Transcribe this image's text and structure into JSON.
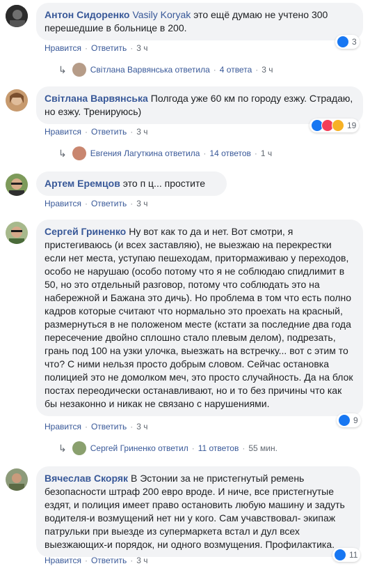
{
  "labels": {
    "like": "Нравится",
    "reply": "Ответить",
    "sep": "·"
  },
  "comments": [
    {
      "author": "Антон Сидоренко",
      "mention": "Vasily Koryak",
      "text": "это ещё думаю не учтено 300 перешедшие в больнице в 200.",
      "time": "3 ч",
      "reactions": "3",
      "replies": {
        "author": "Світлана Варвянська",
        "action": "ответила",
        "count": "4 ответа",
        "time": "3 ч"
      }
    },
    {
      "author": "Світлана Варвянська",
      "text": "Полгода уже 60 км по городу езжу. Страдаю, но езжу. Тренируюсь)",
      "time": "3 ч",
      "reactions": "19",
      "replies": {
        "author": "Евгения Лагуткина",
        "action": "ответила",
        "count": "14 ответов",
        "time": "1 ч"
      }
    },
    {
      "author": "Артем Еремцов",
      "text": "это п  ц... простите",
      "time": "3 ч"
    },
    {
      "author": "Сергей Гриненко",
      "text": "Ну вот как то да и нет. Вот смотри, я пристегиваюсь (и всех заставляю), не выезжаю на перекрестки если нет места, уступаю пешеходам, притормаживаю у переходов, особо не нарушаю (особо потому что я не соблюдаю спидлимит в 50, но это отдельный разговор, потому что соблюдать это на набережной и Бажана это дичь). Но проблема в том что есть полно кадров которые считают что нормально это проехать на красный, размернуться в не положеном месте (кстати за последние два года пересечение двойно сплошно стало плевым делом), подрезать, грань под 100 на узки улочка, выезжать на встречку... вот с этим то что? С ними нельзя просто добрым словом. Сейчас остановка полицией это не домолком меч, это просто случайность. Да на блок постах переодически останавливают, но и то без причины что как бы незаконно и никак не связано с нарушениями.",
      "time": "3 ч",
      "reactions": "9",
      "replies": {
        "author": "Сергей Гриненко",
        "action": "ответил",
        "count": "11 ответов",
        "time": "55 мин."
      }
    },
    {
      "author": "Вячеслав Скоряк",
      "text": "В Эстонии за не пристегнутый ремень безопасности штраф 200 евро вроде. И ниче, все пристегнутые ездят, и полиция имеет право остановить любую машину и задуть водителя-и возмущений нет ни у кого. Сам учавствовал- экипаж патрульки при выезде из супермаркета встал и дул всех выезжающих-и порядок, ни одного возмущения. Профилактика.",
      "time": "3 ч",
      "reactions": "11"
    }
  ],
  "colors": {
    "link": "#385898",
    "bubble": "#f2f3f5",
    "meta": "#606770",
    "like": "#1877f2",
    "love": "#f33e58",
    "haha": "#f7b125"
  }
}
